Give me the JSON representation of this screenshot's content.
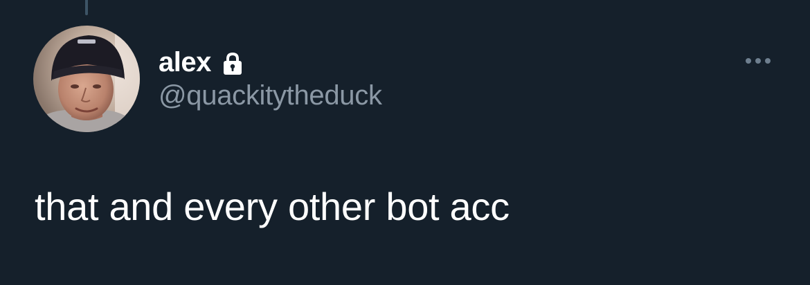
{
  "tweet": {
    "author": {
      "display_name": "alex",
      "handle": "@quackitytheduck",
      "protected": true,
      "avatar": "profile-photo"
    },
    "text": "that and every other bot acc",
    "more_icon": "more-horizontal-icon",
    "lock_icon": "lock-icon"
  },
  "colors": {
    "background": "#15202b",
    "text": "#ffffff",
    "secondary_text": "#8b98a5",
    "thread_line": "#3d5466",
    "more_dots": "#6e7f8f"
  }
}
